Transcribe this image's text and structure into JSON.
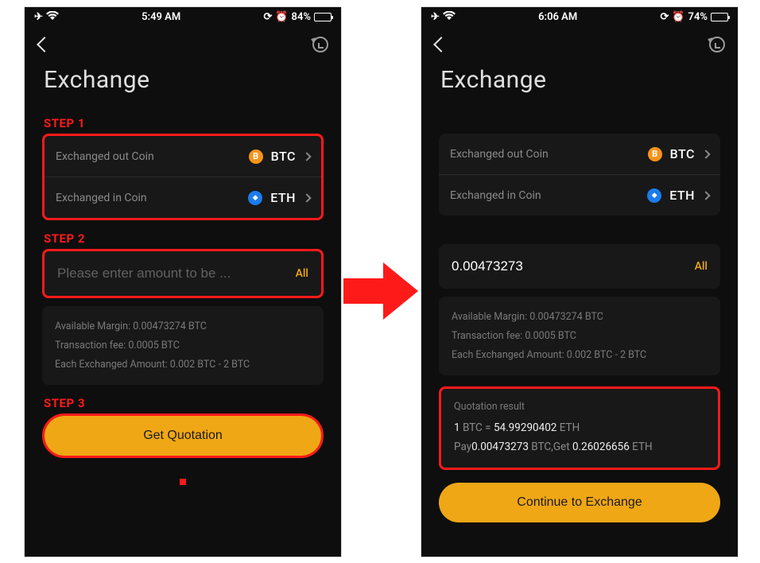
{
  "left": {
    "status": {
      "time": "5:49 AM",
      "battery_pct": "84%",
      "battery_fill": 84
    },
    "title": "Exchange",
    "steps": {
      "s1": "STEP 1",
      "s2": "STEP 2",
      "s3": "STEP 3"
    },
    "coin_out_label": "Exchanged out Coin",
    "coin_out_sym": "BTC",
    "coin_in_label": "Exchanged in Coin",
    "coin_in_sym": "ETH",
    "amount_placeholder": "Please enter amount to be ...",
    "amount_value": "",
    "all": "All",
    "info": {
      "avail": "Available Margin:  0.00473274 BTC",
      "fee": "Transaction fee:  0.0005 BTC",
      "range": "Each Exchanged Amount: 0.002 BTC  -  2 BTC"
    },
    "button": "Get Quotation"
  },
  "right": {
    "status": {
      "time": "6:06 AM",
      "battery_pct": "74%",
      "battery_fill": 74
    },
    "title": "Exchange",
    "coin_out_label": "Exchanged out Coin",
    "coin_out_sym": "BTC",
    "coin_in_label": "Exchanged in Coin",
    "coin_in_sym": "ETH",
    "amount_value": "0.00473273",
    "all": "All",
    "info": {
      "avail": "Available Margin:  0.00473274 BTC",
      "fee": "Transaction fee:  0.0005 BTC",
      "range": "Each Exchanged Amount: 0.002 BTC  -  2 BTC"
    },
    "quote": {
      "title": "Quotation result",
      "rate_pre": "1",
      "rate_mid": " BTC = ",
      "rate_val": "54.99290402",
      "rate_suf": " ETH",
      "pay_label": "Pay",
      "pay_amount": "0.00473273",
      "pay_unit": " BTC,",
      "get_label": "Get ",
      "get_amount": "0.26026656",
      "get_unit": " ETH"
    },
    "button": "Continue to Exchange"
  }
}
